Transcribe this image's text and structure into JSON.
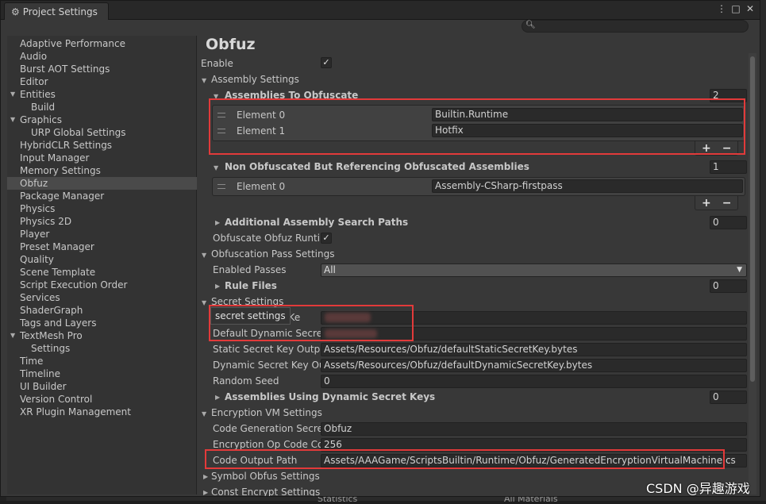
{
  "window": {
    "tab_title": "Project Settings",
    "menu_icon": "kebab-menu-icon",
    "maximize_icon": "maximize-icon",
    "close_icon": "close-icon",
    "search": {
      "placeholder": "",
      "value": ""
    }
  },
  "sidebar": {
    "items": [
      {
        "label": "Adaptive Performance"
      },
      {
        "label": "Audio"
      },
      {
        "label": "Burst AOT Settings"
      },
      {
        "label": "Editor"
      },
      {
        "label": "Entities"
      },
      {
        "label": "Build"
      },
      {
        "label": "Graphics"
      },
      {
        "label": "URP Global Settings"
      },
      {
        "label": "HybridCLR Settings"
      },
      {
        "label": "Input Manager"
      },
      {
        "label": "Memory Settings"
      },
      {
        "label": "Obfuz"
      },
      {
        "label": "Package Manager"
      },
      {
        "label": "Physics"
      },
      {
        "label": "Physics 2D"
      },
      {
        "label": "Player"
      },
      {
        "label": "Preset Manager"
      },
      {
        "label": "Quality"
      },
      {
        "label": "Scene Template"
      },
      {
        "label": "Script Execution Order"
      },
      {
        "label": "Services"
      },
      {
        "label": "ShaderGraph"
      },
      {
        "label": "Tags and Layers"
      },
      {
        "label": "TextMesh Pro"
      },
      {
        "label": "Settings"
      },
      {
        "label": "Time"
      },
      {
        "label": "Timeline"
      },
      {
        "label": "UI Builder"
      },
      {
        "label": "Version Control"
      },
      {
        "label": "XR Plugin Management"
      }
    ],
    "selected": "Obfuz"
  },
  "main": {
    "title": "Obfuz",
    "enable_label": "Enable",
    "enable_checked": true,
    "assembly_settings": {
      "label": "Assembly Settings",
      "to_obfuscate": {
        "label": "Assemblies To Obfuscate",
        "count": "2",
        "elements": [
          {
            "label": "Element 0",
            "value": "Builtin.Runtime"
          },
          {
            "label": "Element 1",
            "value": "Hotfix"
          }
        ]
      },
      "non_obfuscated": {
        "label": "Non Obfuscated But Referencing Obfuscated Assemblies",
        "count": "1",
        "elements": [
          {
            "label": "Element 0",
            "value": "Assembly-CSharp-firstpass"
          }
        ]
      },
      "additional_paths": {
        "label": "Additional Assembly Search Paths",
        "count": "0"
      },
      "obfuscate_runtime": {
        "label": "Obfuscate Obfuz Runtim",
        "checked": true
      }
    },
    "obfuscation_pass": {
      "label": "Obfuscation Pass Settings",
      "enabled_passes_label": "Enabled Passes",
      "enabled_passes_value": "All",
      "rule_files_label": "Rule Files",
      "rule_files_count": "0"
    },
    "secret": {
      "label": "Secret Settings",
      "tooltip": "secret settings",
      "default_static_label_tail": "ecret Ke",
      "default_dynamic_label": "Default Dynamic Secret",
      "static_output_label": "Static Secret Key Outpu",
      "static_output_value": "Assets/Resources/Obfuz/defaultStaticSecretKey.bytes",
      "dynamic_output_label": "Dynamic Secret Key Ou",
      "dynamic_output_value": "Assets/Resources/Obfuz/defaultDynamicSecretKey.bytes",
      "random_seed_label": "Random Seed",
      "random_seed_value": "0",
      "dynamic_assemblies_label": "Assemblies Using Dynamic Secret Keys",
      "dynamic_assemblies_count": "0"
    },
    "encryption_vm": {
      "label": "Encryption VM Settings",
      "code_gen_label": "Code Generation Secret",
      "code_gen_value": "Obfuz",
      "opcode_label": "Encryption Op Code Cou",
      "opcode_value": "256",
      "output_path_label": "Code Output Path",
      "output_path_value": "Assets/AAAGame/ScriptsBuiltin/Runtime/Obfuz/GeneratedEncryptionVirtualMachine.cs"
    },
    "symbol_obfus": {
      "label": "Symbol Obfus Settings"
    },
    "const_encrypt": {
      "label": "Const Encrypt Settings"
    }
  },
  "background": {
    "peek_left": "Statistics",
    "peek_right": "All Materials"
  },
  "watermark": "CSDN @异趣游戏",
  "colors": {
    "highlight_red": "#e23a3a",
    "selected_row": "#4a4a4a",
    "panel_bg": "#383838"
  }
}
